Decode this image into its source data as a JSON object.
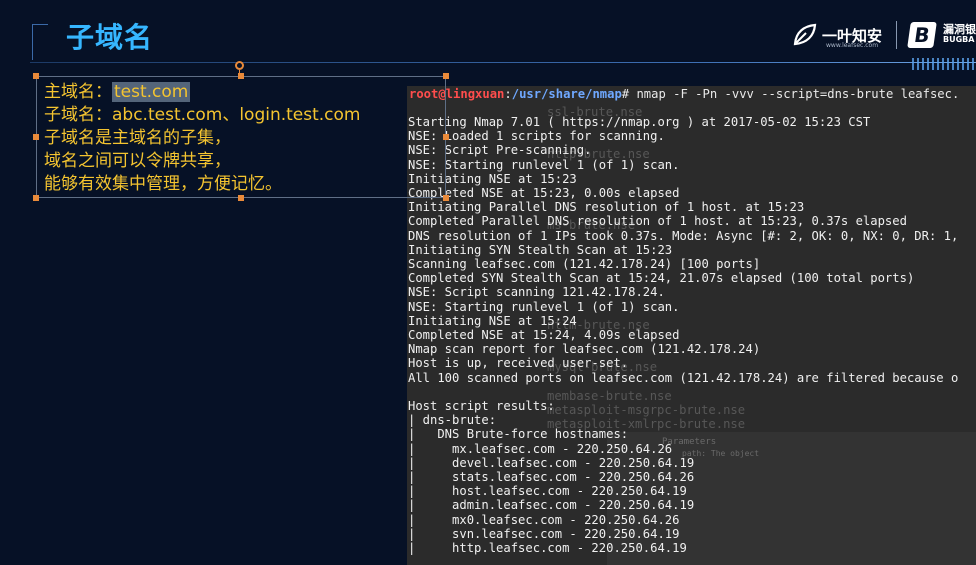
{
  "slide": {
    "title": "子域名"
  },
  "logo": {
    "brand": "一叶知安",
    "brand_sub": "www.leafsec.com",
    "mark": "B",
    "brand2_line1": "漏洞银",
    "brand2_line2": "BUGBA"
  },
  "textbox": {
    "line1_label": "主域名：",
    "line1_value": "test.com",
    "line2": "子域名：abc.test.com、login.test.com",
    "line3": "子域名是主域名的子集，",
    "line4": "域名之间可以令牌共享，",
    "line5": "能够有效集中管理，方便记忆。"
  },
  "terminal": {
    "prompt_user": "root@lingxuan",
    "prompt_path": "/usr/share/nmap",
    "prompt_cmd": "# nmap -F -Pn -vvv --script=dns-brute leafsec.",
    "output": [
      "Starting Nmap 7.01 ( https://nmap.org ) at 2017-05-02 15:23 CST",
      "NSE: Loaded 1 scripts for scanning.",
      "NSE: Script Pre-scanning.",
      "NSE: Starting runlevel 1 (of 1) scan.",
      "Initiating NSE at 15:23",
      "Completed NSE at 15:23, 0.00s elapsed",
      "Initiating Parallel DNS resolution of 1 host. at 15:23",
      "Completed Parallel DNS resolution of 1 host. at 15:23, 0.37s elapsed",
      "DNS resolution of 1 IPs took 0.37s. Mode: Async [#: 2, OK: 0, NX: 0, DR: 1,",
      "Initiating SYN Stealth Scan at 15:23",
      "Scanning leafsec.com (121.42.178.24) [100 ports]",
      "Completed SYN Stealth Scan at 15:24, 21.07s elapsed (100 total ports)",
      "NSE: Script scanning 121.42.178.24.",
      "NSE: Starting runlevel 1 (of 1) scan.",
      "Initiating NSE at 15:24",
      "Completed NSE at 15:24, 4.09s elapsed",
      "Nmap scan report for leafsec.com (121.42.178.24)",
      "Host is up, received user-set.",
      "All 100 scanned ports on leafsec.com (121.42.178.24) are filtered because o",
      "",
      "Host script results:",
      "| dns-brute:",
      "|   DNS Brute-force hostnames:",
      "|     mx.leafsec.com - 220.250.64.26",
      "|     devel.leafsec.com - 220.250.64.19",
      "|     stats.leafsec.com - 220.250.64.26",
      "|     host.leafsec.com - 220.250.64.19",
      "|     admin.leafsec.com - 220.250.64.19",
      "|     mx0.leafsec.com - 220.250.64.26",
      "|     svn.leafsec.com - 220.250.64.19",
      "|     http.leafsec.com - 220.250.64.19"
    ],
    "ghost_lines": [
      "ssl-brute.nse",
      "http-brute.nse",
      "ms-brute.nse",
      "ntlm-brute.nse",
      "mysql-brute.nse",
      "membase-brute.nse",
      "metasploit-msgrpc-brute.nse",
      "metasploit-xmlrpc-brute.nse",
      "Parameters",
      "path: The object"
    ]
  }
}
